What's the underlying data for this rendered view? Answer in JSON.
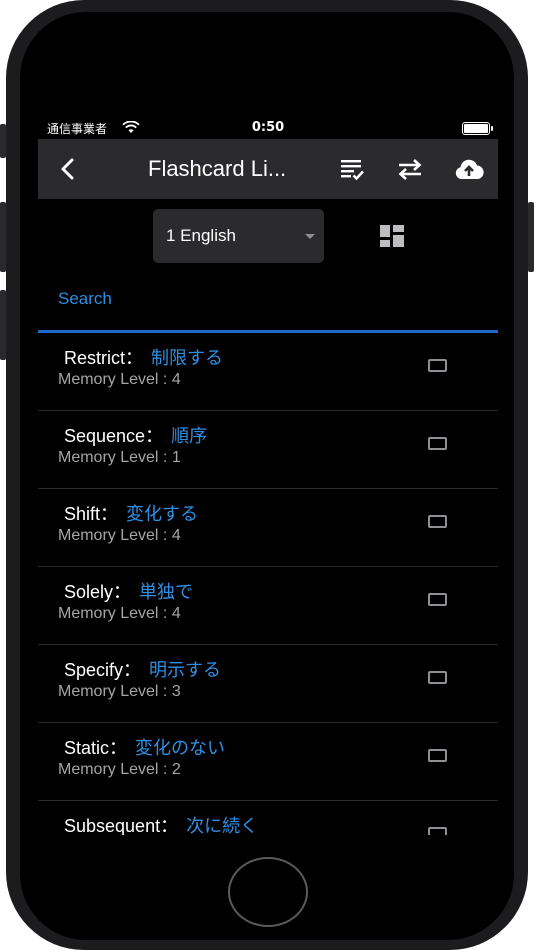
{
  "status_bar": {
    "carrier": "通信事業者",
    "time": "0:50"
  },
  "nav": {
    "title": "Flashcard Li..."
  },
  "icons": {
    "back": "chevron-left-icon",
    "checklist": "checklist-icon",
    "swap": "swap-arrows-icon",
    "upload": "cloud-upload-icon",
    "layout": "dashboard-grid-icon"
  },
  "controls": {
    "deck_selected": "1 English"
  },
  "search": {
    "placeholder": "Search"
  },
  "colors": {
    "accent": "#2f8fe3",
    "nav_bg": "#2b2b2d",
    "background": "#000000"
  },
  "cards": [
    {
      "word": "Restrict",
      "separator": "：",
      "meaning": "制限する",
      "memory": "Memory Level : 4"
    },
    {
      "word": "Sequence",
      "separator": "：",
      "meaning": "順序",
      "memory": "Memory Level : 1"
    },
    {
      "word": "Shift",
      "separator": "：",
      "meaning": "変化する",
      "memory": "Memory Level : 4"
    },
    {
      "word": "Solely",
      "separator": "：",
      "meaning": "単独で",
      "memory": "Memory Level : 4"
    },
    {
      "word": "Specify",
      "separator": "：",
      "meaning": "明示する",
      "memory": "Memory Level : 3"
    },
    {
      "word": "Static",
      "separator": "：",
      "meaning": "変化のない",
      "memory": "Memory Level : 2"
    },
    {
      "word": "Subsequent",
      "separator": "：",
      "meaning": "次に続く",
      "memory": ""
    }
  ]
}
